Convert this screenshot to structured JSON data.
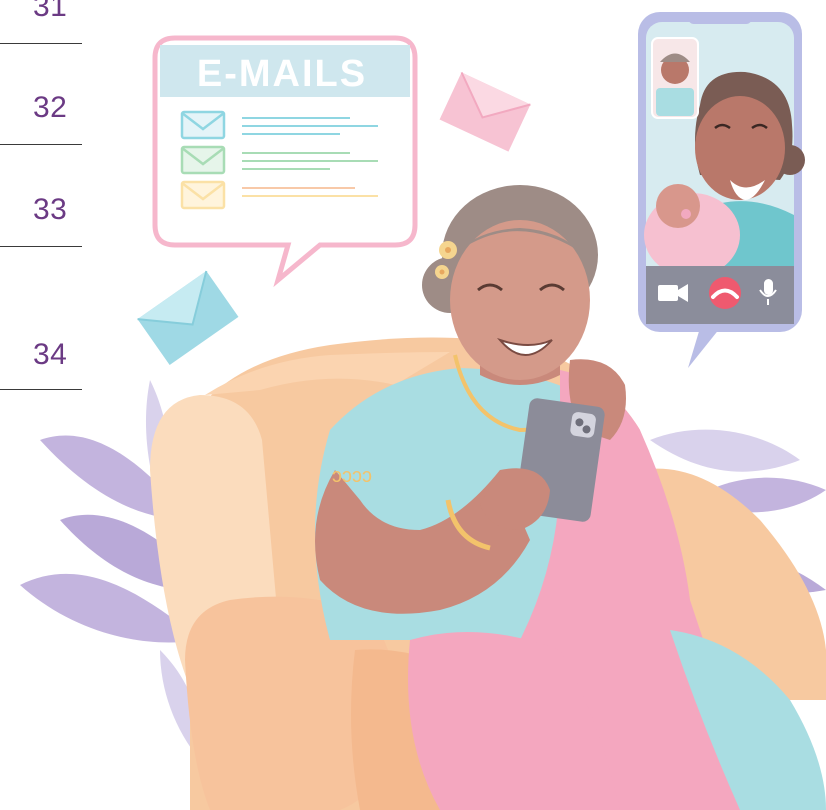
{
  "page_numbers": [
    "31",
    "32",
    "33",
    "34"
  ],
  "email_card": {
    "title": "E-MAILS",
    "envelope_colors": [
      "#8fd6e2",
      "#a8dcb5",
      "#fbe1a6"
    ]
  },
  "video_call": {
    "controls": [
      "camera-icon",
      "end-call-icon",
      "microphone-icon"
    ],
    "end_call_color": "#ef5a6f"
  },
  "colors": {
    "page_number_color": "#6b3a84",
    "skin": "#d49a8a",
    "shirt": "#a9dde2",
    "saree": "#f4a7bf",
    "armchair": "#f7c9a0",
    "hair": "#9e8c86",
    "phone_frame": "#b9bde6",
    "leaf": "#b9a9d8"
  }
}
